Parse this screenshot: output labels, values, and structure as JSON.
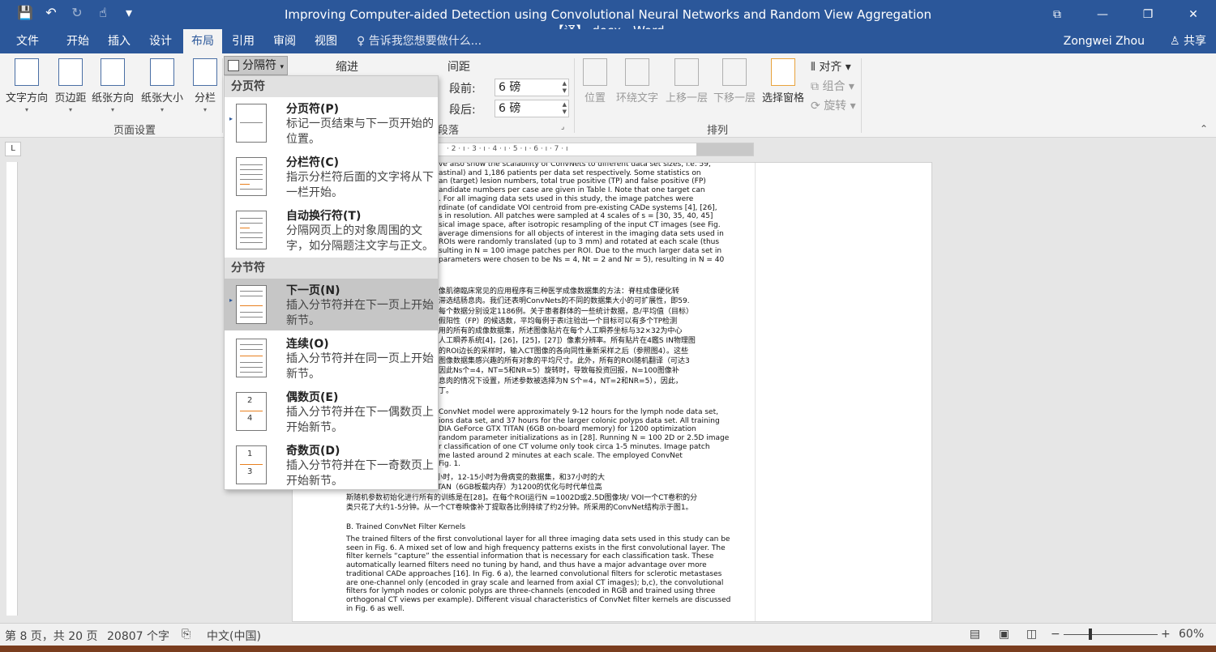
{
  "window": {
    "title": "Improving Computer-aided Detection using Convolutional Neural Networks and Random View Aggregation【译】.docx - Word",
    "controls": [
      "⧉",
      "—",
      "❐",
      "✕"
    ]
  },
  "qat": {
    "save": "💾",
    "undo": "↶",
    "redo": "↻",
    "touch": "☝",
    "more": "▾"
  },
  "tabs": [
    "文件",
    "开始",
    "插入",
    "设计",
    "布局",
    "引用",
    "审阅",
    "视图"
  ],
  "tell_me": "♀ 告诉我您想要做什么...",
  "user": "Zongwei Zhou",
  "share": "共享",
  "ribbon": {
    "page_setup": {
      "buttons": [
        "文字方向",
        "页边距",
        "纸张方向",
        "纸张大小",
        "分栏"
      ],
      "label": "页面设置"
    },
    "breaks_button": "分隔符",
    "indent_label": "缩进",
    "spacing_label": "间距",
    "before_label": "段前:",
    "before_value": "6 磅",
    "after_label": "段后:",
    "after_value": "6 磅",
    "paragraph_label": "段落",
    "arrange": {
      "buttons": [
        "位置",
        "环绕文字",
        "上移一层",
        "下移一层",
        "选择窗格"
      ],
      "align": "对齐",
      "group": "组合",
      "rotate": "旋转",
      "label": "排列"
    }
  },
  "menu": {
    "page_breaks_header": "分页符",
    "section_breaks_header": "分节符",
    "items": [
      {
        "title": "分页符(P)",
        "desc": "标记一页结束与下一页开始的位置。"
      },
      {
        "title": "分栏符(C)",
        "desc": "指示分栏符后面的文字将从下一栏开始。"
      },
      {
        "title": "自动换行符(T)",
        "desc": "分隔网页上的对象周围的文字，如分隔题注文字与正文。"
      },
      {
        "title": "下一页(N)",
        "desc": "插入分节符并在下一页上开始新节。"
      },
      {
        "title": "连续(O)",
        "desc": "插入分节符并在同一页上开始新节。"
      },
      {
        "title": "偶数页(E)",
        "desc": "插入分节符并在下一偶数页上开始新节。"
      },
      {
        "title": "奇数页(D)",
        "desc": "插入分节符并在下一奇数页上开始新节。"
      }
    ]
  },
  "ruler": {
    "text": "· 2 · ı · 3 · ı · 4 · ı · 5 · ı · 6 · ı · 7 · ı"
  },
  "document": {
    "para1": "ve also show the scalability of ConvNets to different data set sizes, i.e. 59,\nastinal) and 1,186 patients per data set respectively. Some statistics on\nan (target) lesion numbers, total true positive (TP) and false positive (FP)\nandidate numbers per case are given in Table I. Note that one target can\n. For all imaging data sets used in this study, the image patches were\nrdinate (of candidate VOI centroid from pre-existing CADe systems [4], [26],\ns in resolution. All patches were sampled at 4 scales of s = [30, 35, 40, 45]\nsical image space, after isotropic resampling of the input CT images (see Fig.\naverage dimensions for all objects of interest in the imaging data sets used in\nROIs were randomly translated (up to 3 mm) and rotated at each scale (thus\nsulting in N = 100 image patches per ROI. Due to the much larger data set in\nparameters were chosen to be Ns = 4, Nt = 2 and Nr = 5), resulting in N = 40",
    "para2": "像肌德臨床常见的应用程序有三种医学成像数据集的方法：脊柱成像硬化转\n滞选结肠息肉。我们还表明ConvNets的不同的数据集大小的可扩展性，即59.\n每个数据分别设定1186例。关于患者群体的一些统计数据，息/平均值（目标）\n假阳性（FP）的候选数，平均每例于表I注验出一个目标可以有多个TP检测\n用的所有的成像数据集，所述图像贴片在每个人工瞬养坐标与32×32为中心\n人工瞬养系统[4]，[26]，[25]，[27]）像素分辨率。所有贴片在4鑑S IN物理图\n的ROI边长的采样时，输入CT图像的各向同性重新采样之后（参照图4）。这些\n图像数据集感兴趣的所有对象的平均尺寸。此外，所有的ROI随机翻译（可达3\n因此Ns个=4，NT=5和NR=5）旋转时，导致每投资回报，N=100图像补\n息肉的情况下设置，所述参数被选择为N S个=4，NT=2和NR=5），因此，\n丁。",
    "para3": "ConvNet model were approximately 9-12 hours for the lymph node data set,\nions data set, and 37 hours for the larger colonic polyps data set. All training\nDIA GeForce GTX TITAN (6GB on-board memory) for 1200 optimization\nrandom parameter initializations as in [28]. Running N = 100 2D or 2.5D image\nr classification of one CT volume only took circa 1-5 minutes. Image patch\nme lasted around 2 minutes at each scale. The employed ConvNet\nFig. 1.",
    "para4": "分别为淋巴结数据集的9-12小时，12-15小时为骨病变的数据集，和37小时的大\n了NVIDIA GeForce GTX TITAN（6GB板载内存）为1200的优化与时代单位高\n斯随机参数初始化进行所有的训练是在[28]。在每个ROI运行N =1002D或2.5D图像块/ VOI一个CT卷积的分\n类只花了大约1-5分钟。从一个CT卷映像补丁提取各比例持续了约2分钟。所采用的ConvNet结构示于图1。",
    "heading_b": "B. Trained ConvNet Filter Kernels",
    "para5": "The trained filters of the first convolutional layer for all three imaging data sets used in this study can be\nseen in Fig. 6. A mixed set of low and high frequency patterns exists in the first convolutional layer. The\nfilter kernels “capture” the essential information that is necessary for each classification task. These\nautomatically learned filters need no tuning by hand, and thus have a major advantage over more\ntraditional CADe approaches [16]. In Fig. 6 a), the learned convolutional filters for sclerotic metastases\nare one-channel only (encoded in gray scale and learned from axial CT images); b,c), the convolutional\nfilters for lymph nodes or colonic polyps are three-channels (encoded in RGB and trained using three\northogonal CT views per example). Different visual characteristics of ConvNet filter kernels are discussed\nin Fig. 6 as well."
  },
  "status": {
    "page": "第 8 页，共 20 页",
    "words": "20807 个字",
    "lang": "中文(中国)",
    "zoom": "60%",
    "minus": "−",
    "plus": "+"
  },
  "colors": {
    "accent": "#2b579a",
    "menu_hover": "#c6c6c6"
  }
}
